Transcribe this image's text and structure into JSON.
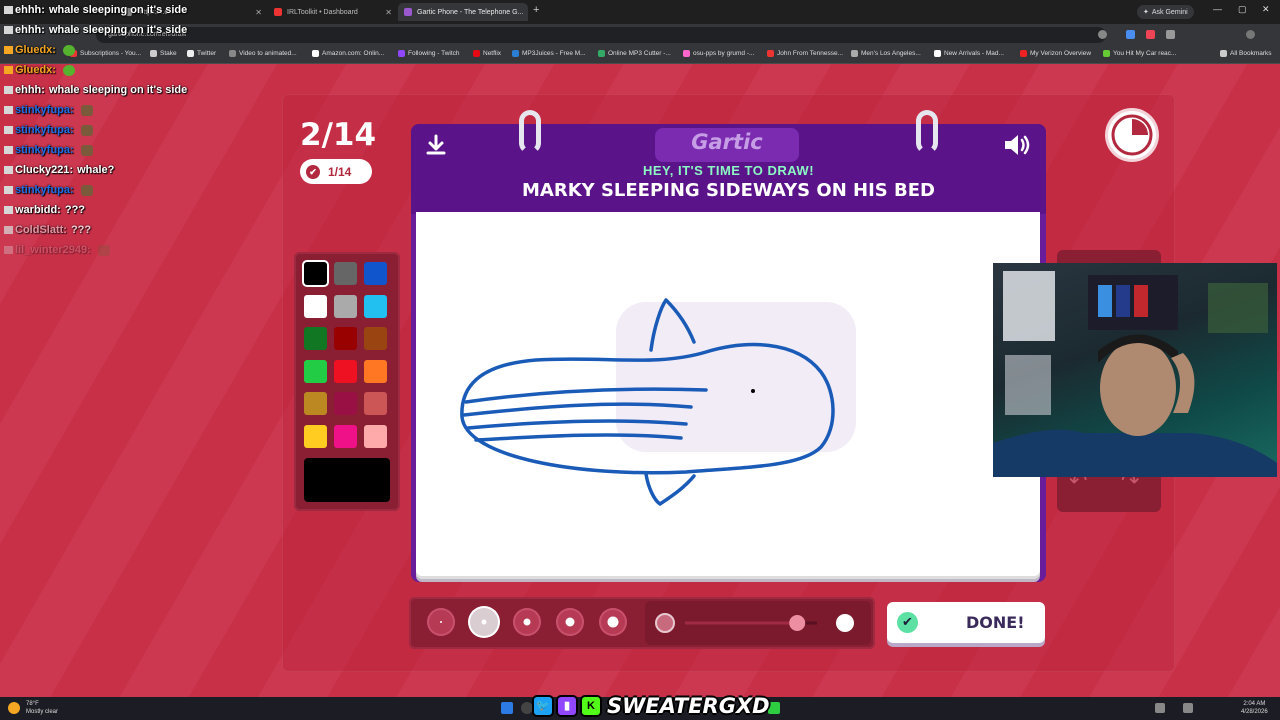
{
  "browser": {
    "tabs": [
      {
        "label": "\"https://t.c...",
        "active": false
      },
      {
        "label": "IRLToolkit • Dashboard",
        "active": false
      },
      {
        "label": "Gartic Phone - The Telephone G...",
        "active": true
      }
    ],
    "ask_gemini": "Ask Gemini",
    "url": "garticphone.com/en/draw",
    "bookmarks": [
      "Subscriptions - You...",
      "Stake",
      "Twitter",
      "Video to animated...",
      "Amazon.com: Onlin...",
      "Following - Twitch",
      "Netflix",
      "MP3Juices - Free M...",
      "Online MP3 Cutter -...",
      "osu-pps by grumd -...",
      "John From Tennesse...",
      "Men's Los Angeles...",
      "New Arrivals - Mad...",
      "My Verizon Overview",
      "You Hit My Car reac..."
    ],
    "all_bookmarks": "All Bookmarks"
  },
  "chat": [
    {
      "user": "ehhh",
      "message": "whale sleeping on it's side",
      "color": "#ffffff"
    },
    {
      "user": "ehhh",
      "message": "whale sleeping on it's side",
      "color": "#ffffff"
    },
    {
      "user": "Gluedx",
      "message": "",
      "color": "#f5a623",
      "emote": "green"
    },
    {
      "user": "Gluedx",
      "message": "",
      "color": "#f5a623",
      "emote": "green"
    },
    {
      "user": "ehhh",
      "message": "whale sleeping on it's side",
      "color": "#ffffff"
    },
    {
      "user": "stinkyfupa",
      "message": "",
      "color": "#1e6ee8",
      "emote": "face"
    },
    {
      "user": "stinkyfupa",
      "message": "",
      "color": "#1e6ee8",
      "emote": "face"
    },
    {
      "user": "stinkyfupa",
      "message": "",
      "color": "#1e6ee8",
      "emote": "face"
    },
    {
      "user": "Clucky221",
      "message": "whale?",
      "color": "#ffffff"
    },
    {
      "user": "stinkyfupa",
      "message": "",
      "color": "#1e6ee8",
      "emote": "face"
    },
    {
      "user": "warbidd",
      "message": "???",
      "color": "#ffffff"
    },
    {
      "user": "ColdSlatt",
      "message": "???",
      "color": "#e7b5bf"
    },
    {
      "user": "lil_winter2949",
      "message": "",
      "color": "#d98a98",
      "emote": "face"
    }
  ],
  "game": {
    "round": "2/14",
    "done_count": "1/14",
    "logo": "Gartic",
    "prompt_sub": "HEY, IT'S TIME TO DRAW!",
    "prompt": "MARKY SLEEPING SIDEWAYS ON HIS BED",
    "done_button": "DONE!",
    "palette": [
      "#000000",
      "#666666",
      "#1155cc",
      "#ffffff",
      "#aaaaaa",
      "#22c0f0",
      "#117722",
      "#990000",
      "#994411",
      "#22cc44",
      "#ee1122",
      "#ff7722",
      "#bb8822",
      "#991144",
      "#cc5555",
      "#ffcc22",
      "#ee1188",
      "#ffaaaa"
    ],
    "selected_color": "#000000",
    "brush_sizes": [
      2,
      5,
      7,
      9,
      11
    ],
    "selected_brush": 1,
    "opacity_level": 0.85
  },
  "stream": {
    "name": "SWEATERGXD"
  },
  "taskbar": {
    "weather_temp": "78°F",
    "weather_desc": "Mostly clear",
    "time": "2:04 AM",
    "date": "4/28/2026"
  }
}
